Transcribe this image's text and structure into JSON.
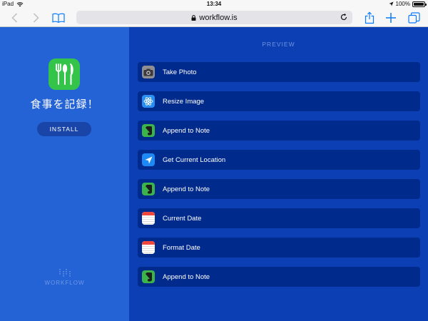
{
  "status_bar": {
    "device": "iPad",
    "time": "13:34",
    "battery": "100%"
  },
  "browser": {
    "url": "workflow.is",
    "icons": {
      "back": "chevron-left-icon",
      "forward": "chevron-right-icon",
      "bookmarks": "book-icon",
      "share": "share-icon",
      "new_tab": "plus-icon",
      "tabs": "tabs-icon",
      "reload": "reload-icon",
      "lock": "lock-icon"
    }
  },
  "app": {
    "name": "食事を記録！",
    "install_label": "INSTALL",
    "brand": "WORKFLOW",
    "icon": "fork-knife-icon"
  },
  "preview": {
    "label": "PREVIEW",
    "actions": [
      {
        "label": "Take Photo",
        "icon": "camera-icon"
      },
      {
        "label": "Resize Image",
        "icon": "atom-icon"
      },
      {
        "label": "Append to Note",
        "icon": "evernote-icon"
      },
      {
        "label": "Get Current Location",
        "icon": "location-arrow-icon"
      },
      {
        "label": "Append to Note",
        "icon": "evernote-icon"
      },
      {
        "label": "Current Date",
        "icon": "calendar-icon"
      },
      {
        "label": "Format Date",
        "icon": "calendar-icon"
      },
      {
        "label": "Append to Note",
        "icon": "evernote-icon"
      }
    ]
  },
  "colors": {
    "left_panel": "#2463d6",
    "right_panel": "#0b3fb3",
    "action_bg": "#002a8c",
    "app_icon": "#34c44a",
    "ios_blue": "#0a7aff"
  }
}
